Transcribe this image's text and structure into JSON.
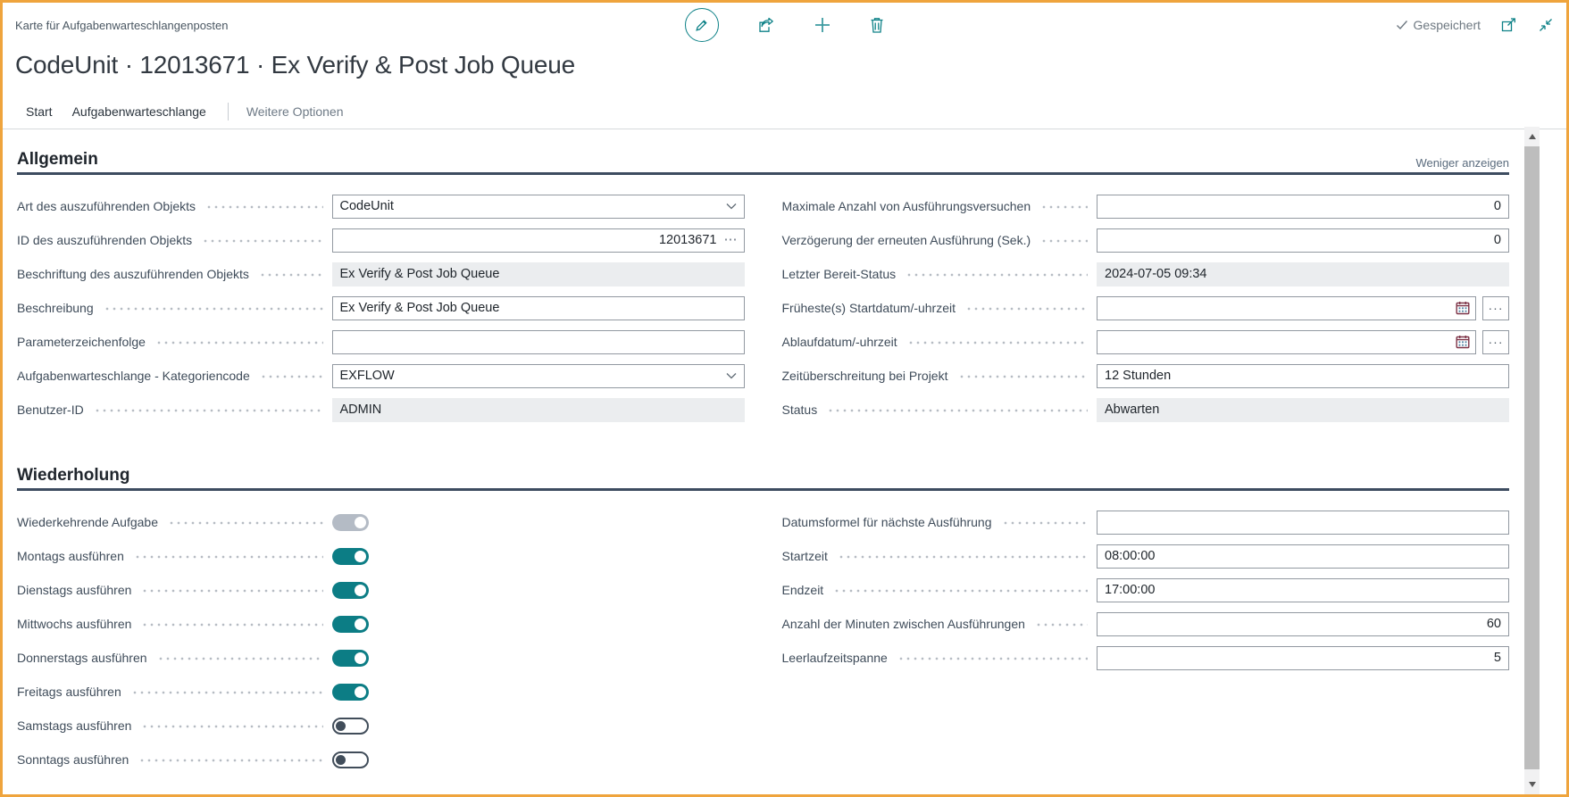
{
  "window": {
    "breadcrumb": "Karte für Aufgabenwarteschlangenposten",
    "title": "CodeUnit · 12013671 · Ex Verify & Post Job Queue",
    "saved_label": "Gespeichert",
    "accent_teal": "#0d8187",
    "border_orange": "#efa43d"
  },
  "menubar": {
    "items": [
      {
        "label": "Start"
      },
      {
        "label": "Aufgabenwarteschlange"
      }
    ],
    "more_label": "Weitere Optionen"
  },
  "icons": {
    "assist_edit": "···",
    "inline_ellipsis": "⋯"
  },
  "general": {
    "title": "Allgemein",
    "show_less": "Weniger anzeigen",
    "left": [
      {
        "label": "Art des auszuführenden Objekts",
        "value": "CodeUnit",
        "type": "dropdown"
      },
      {
        "label": "ID des auszuführenden Objekts",
        "value": "12013671",
        "type": "number-assist"
      },
      {
        "label": "Beschriftung des auszuführenden Objekts",
        "value": "Ex Verify & Post Job Queue",
        "type": "readonly"
      },
      {
        "label": "Beschreibung",
        "value": "Ex Verify & Post Job Queue",
        "type": "text"
      },
      {
        "label": "Parameterzeichenfolge",
        "value": "",
        "type": "text"
      },
      {
        "label": "Aufgabenwarteschlange - Kategoriencode",
        "value": "EXFLOW",
        "type": "dropdown"
      },
      {
        "label": "Benutzer-ID",
        "value": "ADMIN",
        "type": "readonly"
      }
    ],
    "right": [
      {
        "label": "Maximale Anzahl von Ausführungsversuchen",
        "value": "0",
        "type": "number"
      },
      {
        "label": "Verzögerung der erneuten Ausführung (Sek.)",
        "value": "0",
        "type": "number"
      },
      {
        "label": "Letzter Bereit-Status",
        "value": "2024-07-05 09:34",
        "type": "readonly"
      },
      {
        "label": "Früheste(s) Startdatum/-uhrzeit",
        "value": "",
        "type": "datetime"
      },
      {
        "label": "Ablaufdatum/-uhrzeit",
        "value": "",
        "type": "datetime"
      },
      {
        "label": "Zeitüberschreitung bei Projekt",
        "value": "12 Stunden",
        "type": "text"
      },
      {
        "label": "Status",
        "value": "Abwarten",
        "type": "readonly"
      }
    ]
  },
  "recurrence": {
    "title": "Wiederholung",
    "toggles": [
      {
        "label": "Wiederkehrende Aufgabe",
        "state": "on-disabled"
      },
      {
        "label": "Montags ausführen",
        "state": "on"
      },
      {
        "label": "Dienstags ausführen",
        "state": "on"
      },
      {
        "label": "Mittwochs ausführen",
        "state": "on"
      },
      {
        "label": "Donnerstags ausführen",
        "state": "on"
      },
      {
        "label": "Freitags ausführen",
        "state": "on"
      },
      {
        "label": "Samstags ausführen",
        "state": "off"
      },
      {
        "label": "Sonntags ausführen",
        "state": "off"
      }
    ],
    "right": [
      {
        "label": "Datumsformel für nächste Ausführung",
        "value": "",
        "type": "text"
      },
      {
        "label": "Startzeit",
        "value": "08:00:00",
        "type": "text"
      },
      {
        "label": "Endzeit",
        "value": "17:00:00",
        "type": "text"
      },
      {
        "label": "Anzahl der Minuten zwischen Ausführungen",
        "value": "60",
        "type": "number"
      },
      {
        "label": "Leerlaufzeitspanne",
        "value": "5",
        "type": "number"
      }
    ]
  }
}
